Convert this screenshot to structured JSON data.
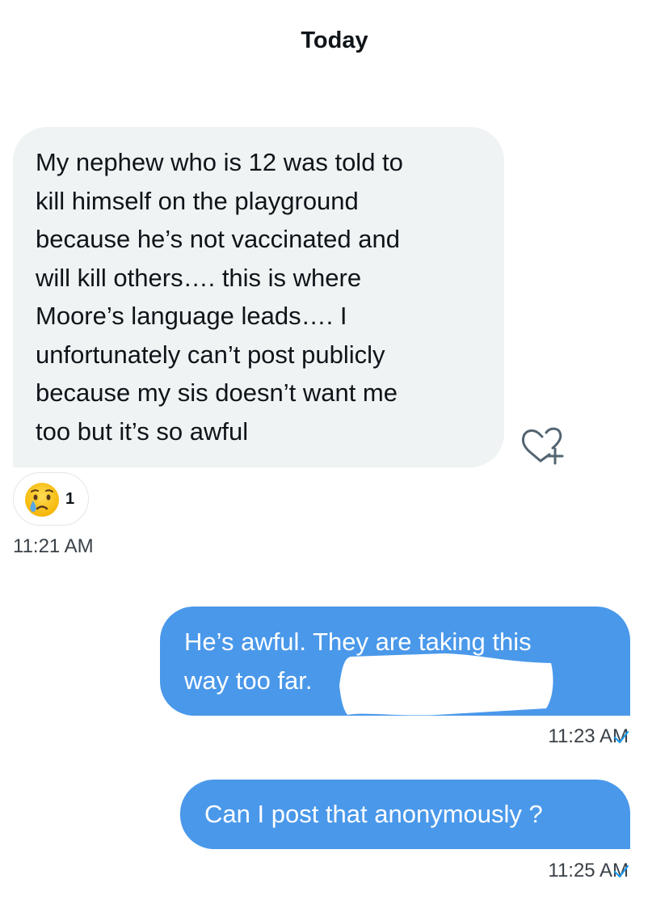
{
  "date_header": "Today",
  "incoming": {
    "lines": [
      "My nephew who is 12 was told to",
      "kill himself on the playground",
      "because he’s not vaccinated and",
      "will kill others…. this is where",
      "Moore’s language leads…. I",
      "unfortunately can’t post publicly",
      "because my sis doesn’t want me",
      "too but it’s so awful"
    ],
    "reaction": {
      "emoji_icon": "crying-face-icon",
      "count": "1"
    },
    "add_reaction_icon": "heart-plus-icon",
    "time": "11:21 AM"
  },
  "outgoing": [
    {
      "lines": [
        "He’s awful. They are taking this",
        "way too far."
      ],
      "time": "11:23 AM",
      "status_icon": "checkmark-icon",
      "redacted": true
    },
    {
      "lines": [
        "Can I post that anonymously ?"
      ],
      "time": "11:25 AM",
      "status_icon": "checkmark-icon",
      "redacted": false
    }
  ],
  "colors": {
    "incoming_bubble": "#eff3f4",
    "outgoing_bubble": "#4a98ea",
    "text": "#0f1419",
    "timestamp": "#3a4148",
    "check": "#1d9bf0"
  }
}
